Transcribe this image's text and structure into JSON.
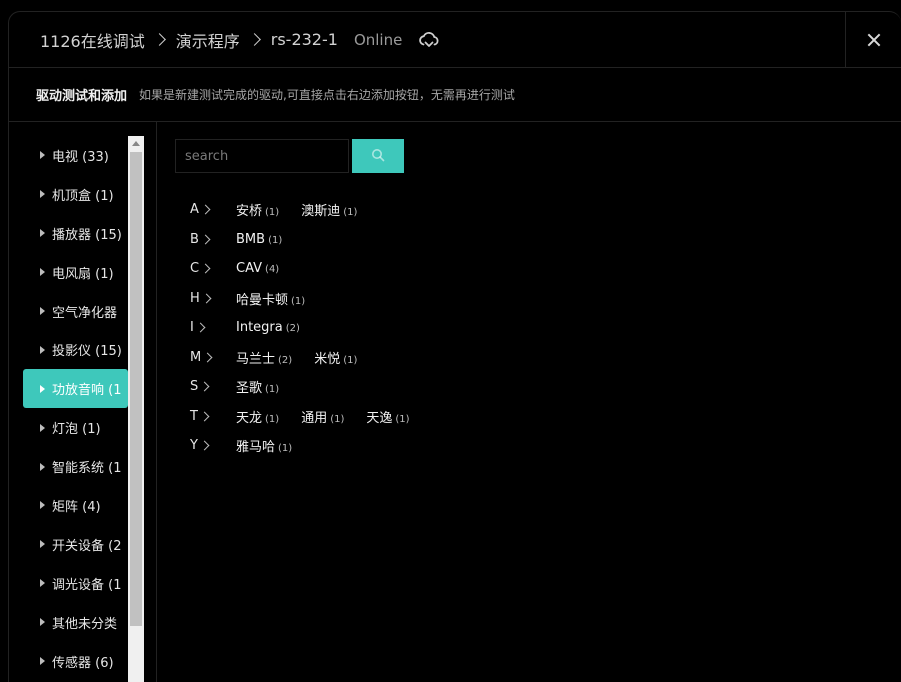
{
  "header": {
    "breadcrumbs": [
      {
        "label": "1126在线调试"
      },
      {
        "label": "演示程序"
      },
      {
        "label": "rs-232-1"
      }
    ],
    "status": "Online",
    "status_icon": "cloud-icon"
  },
  "subheader": {
    "title": "驱动测试和添加",
    "hint": "如果是新建测试完成的驱动,可直接点击右边添加按钮，无需再进行测试"
  },
  "sidebar": {
    "items": [
      {
        "label": "电视 (33)"
      },
      {
        "label": "机顶盒 (1)"
      },
      {
        "label": "播放器 (15)"
      },
      {
        "label": "电风扇 (1)"
      },
      {
        "label": "空气净化器"
      },
      {
        "label": "投影仪 (15)"
      },
      {
        "label": "功放音响 (1"
      },
      {
        "label": "灯泡 (1)"
      },
      {
        "label": "智能系统 (1"
      },
      {
        "label": "矩阵 (4)"
      },
      {
        "label": "开关设备 (2"
      },
      {
        "label": "调光设备 (1"
      },
      {
        "label": "其他未分类"
      },
      {
        "label": "传感器 (6)"
      }
    ],
    "active_index": 6
  },
  "search": {
    "placeholder": "search",
    "value": ""
  },
  "brands": [
    {
      "letter": "A",
      "items": [
        {
          "name": "安桥",
          "count": "(1)"
        },
        {
          "name": "澳斯迪",
          "count": "(1)"
        }
      ]
    },
    {
      "letter": "B",
      "items": [
        {
          "name": "BMB",
          "count": "(1)"
        }
      ]
    },
    {
      "letter": "C",
      "items": [
        {
          "name": "CAV",
          "count": "(4)"
        }
      ]
    },
    {
      "letter": "H",
      "items": [
        {
          "name": "哈曼卡顿",
          "count": "(1)"
        }
      ]
    },
    {
      "letter": "I",
      "items": [
        {
          "name": "Integra",
          "count": "(2)"
        }
      ]
    },
    {
      "letter": "M",
      "items": [
        {
          "name": "马兰士",
          "count": "(2)"
        },
        {
          "name": "米悦",
          "count": "(1)"
        }
      ]
    },
    {
      "letter": "S",
      "items": [
        {
          "name": "圣歌",
          "count": "(1)"
        }
      ]
    },
    {
      "letter": "T",
      "items": [
        {
          "name": "天龙",
          "count": "(1)"
        },
        {
          "name": "通用",
          "count": "(1)"
        },
        {
          "name": "天逸",
          "count": "(1)"
        }
      ]
    },
    {
      "letter": "Y",
      "items": [
        {
          "name": "雅马哈",
          "count": "(1)"
        }
      ]
    }
  ],
  "colors": {
    "accent": "#3ec8bb",
    "background": "#000000",
    "border": "#222222"
  }
}
